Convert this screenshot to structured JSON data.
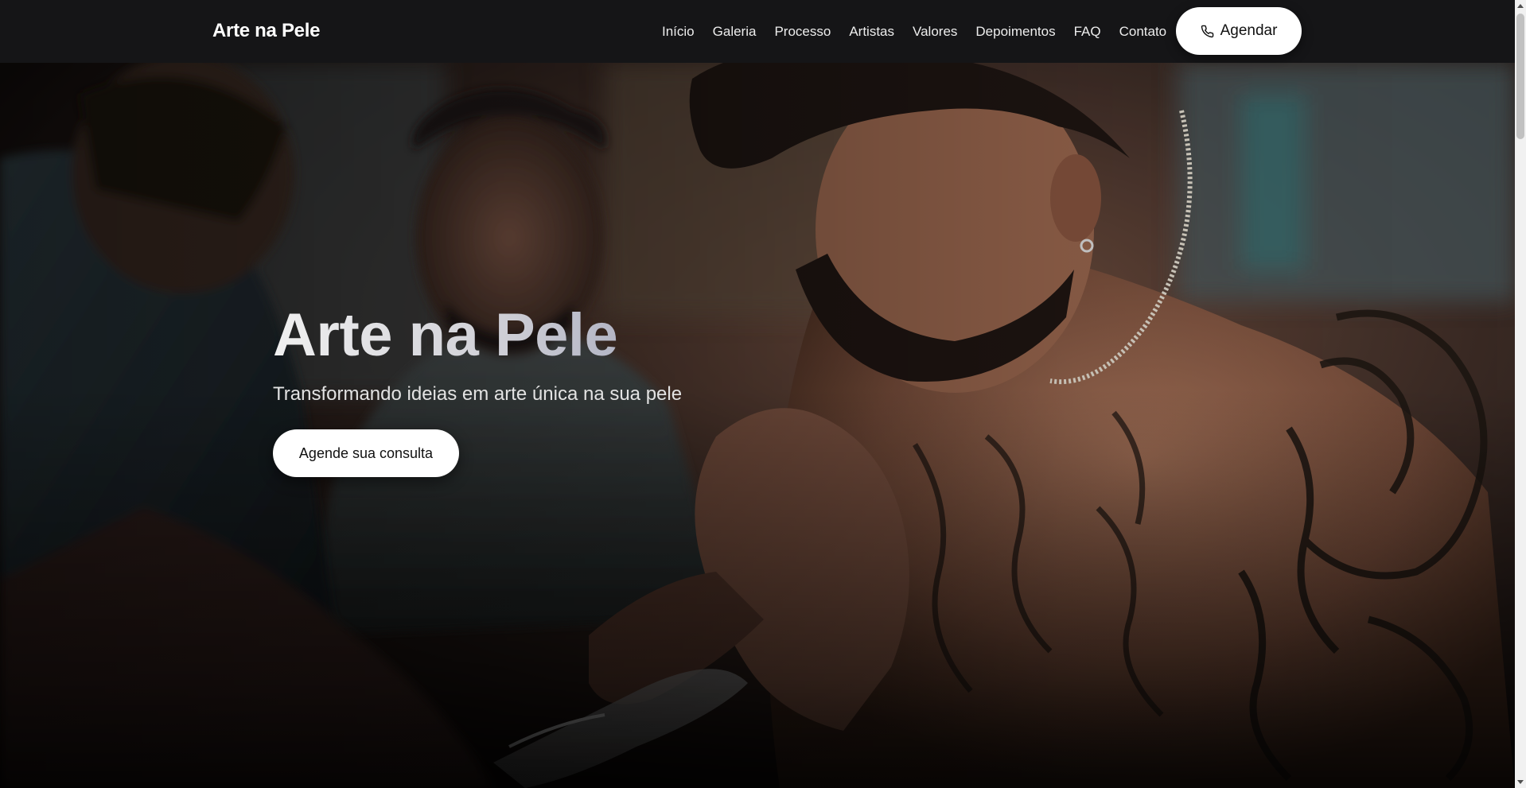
{
  "navbar": {
    "brand": "Arte na Pele",
    "links": [
      "Início",
      "Galeria",
      "Processo",
      "Artistas",
      "Valores",
      "Depoimentos",
      "FAQ",
      "Contato"
    ],
    "cta_label": "Agendar",
    "cta_icon": "phone-icon"
  },
  "hero": {
    "title": "Arte na Pele",
    "subtitle": "Transformando ideias em arte única na sua pele",
    "button_label": "Agende sua consulta",
    "background_description_icon": "hero-photo"
  },
  "colors": {
    "navbar_bg": "#151517",
    "button_bg": "#ffffff",
    "button_text": "#111111",
    "title_gradient_start": "#f0f0f0",
    "title_gradient_end": "#a5a8bc"
  }
}
